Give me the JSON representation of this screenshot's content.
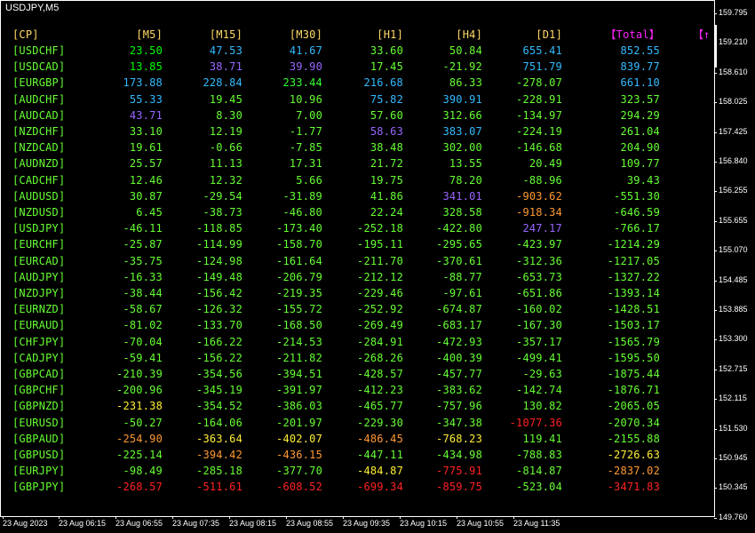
{
  "chart_title": "USDJPY,M5",
  "headers": {
    "pair": "[CP]",
    "m5": "[M5]",
    "m15": "[M15]",
    "m30": "[M30]",
    "h1": "[H1]",
    "h4": "[H4]",
    "d1": "[D1]",
    "total": "【Total】",
    "extra": "【↑"
  },
  "colors": {
    "background": "#000000",
    "header": "#ffd966",
    "total_header": "#ff22ff",
    "green": "#00ff00",
    "lime": "#99ff33",
    "cyan": "#33ccff",
    "blue": "#5599ff",
    "purple": "#9966ff",
    "orange": "#ff9933",
    "yellow": "#ffee33",
    "red": "#ff2222",
    "pale_yellow": "#eeff77"
  },
  "rows": [
    {
      "pair": "[USDCHF]",
      "m5": "23.50",
      "m15": "47.53",
      "m30": "41.67",
      "h1": "33.60",
      "h4": "50.84",
      "d1": "655.41",
      "total": "852.55",
      "col": [
        "#66ff33",
        "#00ff00",
        "#33bbff",
        "#33bbff",
        "#66ff33",
        "#66ff33",
        "#33bbff",
        "#33bbff"
      ]
    },
    {
      "pair": "[USDCAD]",
      "m5": "13.85",
      "m15": "38.71",
      "m30": "39.90",
      "h1": "17.45",
      "h4": "-21.92",
      "d1": "751.79",
      "total": "839.77",
      "col": [
        "#66ff33",
        "#00ff00",
        "#9966ff",
        "#9966ff",
        "#66ff33",
        "#66ff33",
        "#33bbff",
        "#33bbff"
      ]
    },
    {
      "pair": "[EURGBP]",
      "m5": "173.88",
      "m15": "228.84",
      "m30": "233.44",
      "h1": "216.68",
      "h4": "86.33",
      "d1": "-278.07",
      "total": "661.10",
      "col": [
        "#66ff33",
        "#33bbff",
        "#33bbff",
        "#33ff33",
        "#33bbff",
        "#66ff33",
        "#66ff33",
        "#33bbff"
      ]
    },
    {
      "pair": "[AUDCHF]",
      "m5": "55.33",
      "m15": "19.45",
      "m30": "10.96",
      "h1": "75.82",
      "h4": "390.91",
      "d1": "-228.91",
      "total": "323.57",
      "col": [
        "#66ff33",
        "#33bbff",
        "#66ff33",
        "#66ff33",
        "#33bbff",
        "#33bbff",
        "#66ff33",
        "#66ff33"
      ]
    },
    {
      "pair": "[AUDCAD]",
      "m5": "43.71",
      "m15": "8.30",
      "m30": "7.00",
      "h1": "57.60",
      "h4": "312.66",
      "d1": "-134.97",
      "total": "294.29",
      "col": [
        "#66ff33",
        "#9966ff",
        "#66ff33",
        "#66ff33",
        "#66ff33",
        "#66ff33",
        "#66ff33",
        "#66ff33"
      ]
    },
    {
      "pair": "[NZDCHF]",
      "m5": "33.10",
      "m15": "12.19",
      "m30": "-1.77",
      "h1": "58.63",
      "h4": "383.07",
      "d1": "-224.19",
      "total": "261.04",
      "col": [
        "#66ff33",
        "#66ff33",
        "#66ff33",
        "#66ff33",
        "#9966ff",
        "#33bbff",
        "#66ff33",
        "#66ff33"
      ]
    },
    {
      "pair": "[NZDCAD]",
      "m5": "19.61",
      "m15": "-0.66",
      "m30": "-7.85",
      "h1": "38.48",
      "h4": "302.00",
      "d1": "-146.68",
      "total": "204.90",
      "col": [
        "#66ff33",
        "#66ff33",
        "#66ff33",
        "#66ff33",
        "#66ff33",
        "#66ff33",
        "#66ff33",
        "#66ff33"
      ]
    },
    {
      "pair": "[AUDNZD]",
      "m5": "25.57",
      "m15": "11.13",
      "m30": "17.31",
      "h1": "21.72",
      "h4": "13.55",
      "d1": "20.49",
      "total": "109.77",
      "col": [
        "#66ff33",
        "#66ff33",
        "#66ff33",
        "#66ff33",
        "#66ff33",
        "#66ff33",
        "#66ff33",
        "#66ff33"
      ]
    },
    {
      "pair": "[CADCHF]",
      "m5": "12.46",
      "m15": "12.32",
      "m30": "5.66",
      "h1": "19.75",
      "h4": "78.20",
      "d1": "-88.96",
      "total": "39.43",
      "col": [
        "#66ff33",
        "#66ff33",
        "#66ff33",
        "#66ff33",
        "#66ff33",
        "#66ff33",
        "#66ff33",
        "#66ff33"
      ]
    },
    {
      "pair": "[AUDUSD]",
      "m5": "30.87",
      "m15": "-29.54",
      "m30": "-31.89",
      "h1": "41.86",
      "h4": "341.01",
      "d1": "-903.62",
      "total": "-551.30",
      "col": [
        "#66ff33",
        "#66ff33",
        "#66ff33",
        "#66ff33",
        "#66ff33",
        "#9966ff",
        "#ff9933",
        "#66ff33"
      ]
    },
    {
      "pair": "[NZDUSD]",
      "m5": "6.45",
      "m15": "-38.73",
      "m30": "-46.80",
      "h1": "22.24",
      "h4": "328.58",
      "d1": "-918.34",
      "total": "-646.59",
      "col": [
        "#66ff33",
        "#66ff33",
        "#66ff33",
        "#66ff33",
        "#66ff33",
        "#66ff33",
        "#ff9933",
        "#66ff33"
      ]
    },
    {
      "pair": "[USDJPY]",
      "m5": "-46.11",
      "m15": "-118.85",
      "m30": "-173.40",
      "h1": "-252.18",
      "h4": "-422.80",
      "d1": "247.17",
      "total": "-766.17",
      "col": [
        "#66ff33",
        "#66ff33",
        "#66ff33",
        "#66ff33",
        "#66ff33",
        "#66ff33",
        "#9966ff",
        "#66ff33"
      ]
    },
    {
      "pair": "[EURCHF]",
      "m5": "-25.87",
      "m15": "-114.99",
      "m30": "-158.70",
      "h1": "-195.11",
      "h4": "-295.65",
      "d1": "-423.97",
      "total": "-1214.29",
      "col": [
        "#66ff33",
        "#66ff33",
        "#66ff33",
        "#66ff33",
        "#66ff33",
        "#66ff33",
        "#66ff33",
        "#66ff33"
      ]
    },
    {
      "pair": "[EURCAD]",
      "m5": "-35.75",
      "m15": "-124.98",
      "m30": "-161.64",
      "h1": "-211.70",
      "h4": "-370.61",
      "d1": "-312.36",
      "total": "-1217.05",
      "col": [
        "#66ff33",
        "#66ff33",
        "#66ff33",
        "#66ff33",
        "#66ff33",
        "#66ff33",
        "#66ff33",
        "#66ff33"
      ]
    },
    {
      "pair": "[AUDJPY]",
      "m5": "-16.33",
      "m15": "-149.48",
      "m30": "-206.79",
      "h1": "-212.12",
      "h4": "-88.77",
      "d1": "-653.73",
      "total": "-1327.22",
      "col": [
        "#66ff33",
        "#66ff33",
        "#66ff33",
        "#66ff33",
        "#66ff33",
        "#66ff33",
        "#66ff33",
        "#66ff33"
      ]
    },
    {
      "pair": "[NZDJPY]",
      "m5": "-38.44",
      "m15": "-156.42",
      "m30": "-219.35",
      "h1": "-229.46",
      "h4": "-97.61",
      "d1": "-651.86",
      "total": "-1393.14",
      "col": [
        "#66ff33",
        "#66ff33",
        "#66ff33",
        "#66ff33",
        "#66ff33",
        "#66ff33",
        "#66ff33",
        "#66ff33"
      ]
    },
    {
      "pair": "[EURNZD]",
      "m5": "-58.67",
      "m15": "-126.32",
      "m30": "-155.72",
      "h1": "-252.92",
      "h4": "-674.87",
      "d1": "-160.02",
      "total": "-1428.51",
      "col": [
        "#66ff33",
        "#66ff33",
        "#66ff33",
        "#66ff33",
        "#66ff33",
        "#66ff33",
        "#66ff33",
        "#66ff33"
      ]
    },
    {
      "pair": "[EURAUD]",
      "m5": "-81.02",
      "m15": "-133.70",
      "m30": "-168.50",
      "h1": "-269.49",
      "h4": "-683.17",
      "d1": "-167.30",
      "total": "-1503.17",
      "col": [
        "#66ff33",
        "#66ff33",
        "#66ff33",
        "#66ff33",
        "#66ff33",
        "#66ff33",
        "#66ff33",
        "#66ff33"
      ]
    },
    {
      "pair": "[CHFJPY]",
      "m5": "-70.04",
      "m15": "-166.22",
      "m30": "-214.53",
      "h1": "-284.91",
      "h4": "-472.93",
      "d1": "-357.17",
      "total": "-1565.79",
      "col": [
        "#66ff33",
        "#66ff33",
        "#66ff33",
        "#66ff33",
        "#66ff33",
        "#66ff33",
        "#66ff33",
        "#66ff33"
      ]
    },
    {
      "pair": "[CADJPY]",
      "m5": "-59.41",
      "m15": "-156.22",
      "m30": "-211.82",
      "h1": "-268.26",
      "h4": "-400.39",
      "d1": "-499.41",
      "total": "-1595.50",
      "col": [
        "#66ff33",
        "#66ff33",
        "#66ff33",
        "#66ff33",
        "#66ff33",
        "#66ff33",
        "#66ff33",
        "#66ff33"
      ]
    },
    {
      "pair": "[GBPCAD]",
      "m5": "-210.39",
      "m15": "-354.56",
      "m30": "-394.51",
      "h1": "-428.57",
      "h4": "-457.77",
      "d1": "-29.63",
      "total": "-1875.44",
      "col": [
        "#66ff33",
        "#66ff33",
        "#66ff33",
        "#66ff33",
        "#66ff33",
        "#66ff33",
        "#66ff33",
        "#66ff33"
      ]
    },
    {
      "pair": "[GBPCHF]",
      "m5": "-200.96",
      "m15": "-345.19",
      "m30": "-391.97",
      "h1": "-412.23",
      "h4": "-383.62",
      "d1": "-142.74",
      "total": "-1876.71",
      "col": [
        "#66ff33",
        "#66ff33",
        "#66ff33",
        "#66ff33",
        "#66ff33",
        "#66ff33",
        "#66ff33",
        "#66ff33"
      ]
    },
    {
      "pair": "[GBPNZD]",
      "m5": "-231.38",
      "m15": "-354.52",
      "m30": "-386.03",
      "h1": "-465.77",
      "h4": "-757.96",
      "d1": "130.82",
      "total": "-2065.05",
      "col": [
        "#66ff33",
        "#ffee33",
        "#66ff33",
        "#66ff33",
        "#66ff33",
        "#66ff33",
        "#66ff33",
        "#66ff33"
      ]
    },
    {
      "pair": "[EURUSD]",
      "m5": "-50.27",
      "m15": "-164.06",
      "m30": "-201.97",
      "h1": "-229.30",
      "h4": "-347.38",
      "d1": "-1077.36",
      "total": "-2070.34",
      "col": [
        "#66ff33",
        "#66ff33",
        "#66ff33",
        "#66ff33",
        "#66ff33",
        "#66ff33",
        "#ff2222",
        "#66ff33"
      ]
    },
    {
      "pair": "[GBPAUD]",
      "m5": "-254.90",
      "m15": "-363.64",
      "m30": "-402.07",
      "h1": "-486.45",
      "h4": "-768.23",
      "d1": "119.41",
      "total": "-2155.88",
      "col": [
        "#66ff33",
        "#ff9933",
        "#ffee33",
        "#ffee33",
        "#ff9933",
        "#ffee33",
        "#66ff33",
        "#66ff33"
      ]
    },
    {
      "pair": "[GBPUSD]",
      "m5": "-225.14",
      "m15": "-394.42",
      "m30": "-436.15",
      "h1": "-447.11",
      "h4": "-434.98",
      "d1": "-788.83",
      "total": "-2726.63",
      "col": [
        "#66ff33",
        "#66ff33",
        "#ff9933",
        "#ff9933",
        "#66ff33",
        "#66ff33",
        "#66ff33",
        "#ffee33"
      ]
    },
    {
      "pair": "[EURJPY]",
      "m5": "-98.49",
      "m15": "-285.18",
      "m30": "-377.70",
      "h1": "-484.87",
      "h4": "-775.91",
      "d1": "-814.87",
      "total": "-2837.02",
      "col": [
        "#66ff33",
        "#66ff33",
        "#66ff33",
        "#66ff33",
        "#ffee33",
        "#ff2222",
        "#66ff33",
        "#ff9933"
      ]
    },
    {
      "pair": "[GBPJPY]",
      "m5": "-268.57",
      "m15": "-511.61",
      "m30": "-608.52",
      "h1": "-699.34",
      "h4": "-859.75",
      "d1": "-523.04",
      "total": "-3471.83",
      "col": [
        "#66ff33",
        "#ff2222",
        "#ff2222",
        "#ff2222",
        "#ff2222",
        "#ff2222",
        "#66ff33",
        "#ff2222"
      ]
    }
  ],
  "price_ticks": [
    "159.795",
    "159.210",
    "158.610",
    "158.025",
    "157.425",
    "156.840",
    "156.255",
    "155.655",
    "155.070",
    "154.485",
    "153.885",
    "153.300",
    "152.715",
    "152.115",
    "151.530",
    "150.945",
    "150.345",
    "149.760"
  ],
  "time_ticks": [
    "23 Aug 2023",
    "23 Aug 06:15",
    "23 Aug 06:55",
    "23 Aug 07:35",
    "23 Aug 08:15",
    "23 Aug 08:55",
    "23 Aug 09:35",
    "23 Aug 10:15",
    "23 Aug 10:55",
    "23 Aug 11:35"
  ]
}
